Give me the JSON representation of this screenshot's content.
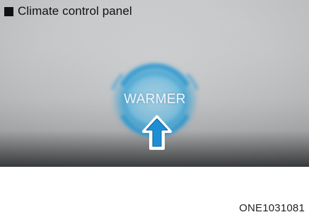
{
  "caption": {
    "icon": "black-square-icon",
    "text": "Climate control panel"
  },
  "button": {
    "label": "WARMER",
    "glow_color": "#2aa0d8"
  },
  "arrow": {
    "icon": "up-arrow-icon",
    "fill_color": "#1e8fd6",
    "outline_color": "#ffffff"
  },
  "figure_code": "ONE1031081"
}
